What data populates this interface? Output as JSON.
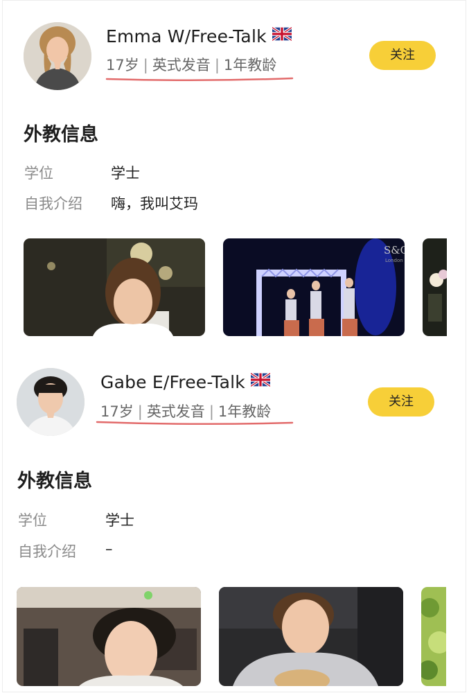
{
  "teachers": [
    {
      "name": "Emma W/Free-Talk",
      "age": "17岁",
      "accent": "英式发音",
      "experience": "1年教龄",
      "follow_label": "关注",
      "section_title": "外教信息",
      "degree_label": "学位",
      "degree_value": "学士",
      "intro_label": "自我介绍",
      "intro_value": "嗨，我叫艾玛",
      "photo_overlay_text": "S&C",
      "photo_overlay_sub": "London"
    },
    {
      "name": "Gabe E/Free-Talk",
      "age": "17岁",
      "accent": "英式发音",
      "experience": "1年教龄",
      "follow_label": "关注",
      "section_title": "外教信息",
      "degree_label": "学位",
      "degree_value": "学士",
      "intro_label": "自我介绍",
      "intro_value": "–"
    }
  ],
  "separator": "|",
  "colors": {
    "follow_button": "#f7cf38",
    "underline": "#e26a6a",
    "label_text": "#8a8a8a"
  },
  "icons": {
    "flag": "uk-flag-icon"
  }
}
